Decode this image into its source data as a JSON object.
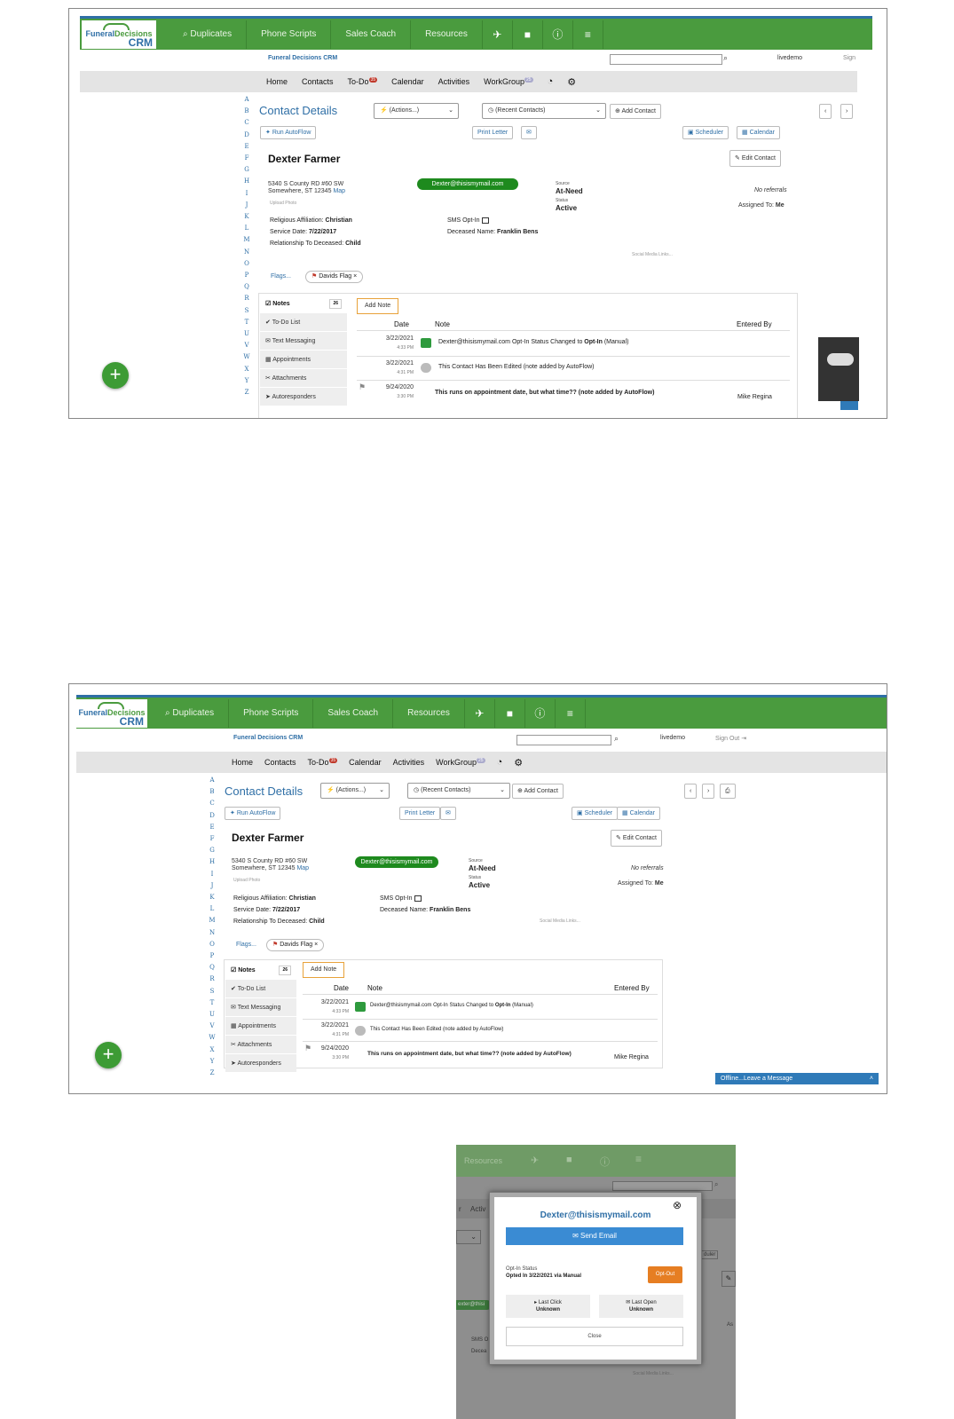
{
  "app": {
    "logo_line1a": "Funeral",
    "logo_line1b": "Decisions",
    "logo_line2": "CRM",
    "subtitle": "Funeral Decisions CRM",
    "username": "livedemo",
    "signin_cut": "Sign",
    "signout": "Sign Out"
  },
  "nav": [
    {
      "label": "Duplicates",
      "icon": "search-icon"
    },
    {
      "label": "Phone Scripts"
    },
    {
      "label": "Sales Coach"
    },
    {
      "label": "Resources"
    }
  ],
  "nav_icons": [
    "rocket-icon",
    "note-icon",
    "help-icon",
    "hamburger-icon"
  ],
  "menu": {
    "home": "Home",
    "contacts": "Contacts",
    "todo": "To-Do",
    "todo_count": "35",
    "calendar": "Calendar",
    "activities": "Activities",
    "workgroup": "WorkGroup",
    "workgroup_count": "25"
  },
  "alphabet": [
    "A",
    "B",
    "C",
    "D",
    "E",
    "F",
    "G",
    "H",
    "I",
    "J",
    "K",
    "L",
    "M",
    "N",
    "O",
    "P",
    "Q",
    "R",
    "S",
    "T",
    "U",
    "V",
    "W",
    "X",
    "Y",
    "Z"
  ],
  "contact": {
    "page_title": "Contact Details",
    "actions_select": "(Actions...)",
    "recent_select": "(Recent Contacts)",
    "add_contact": "Add Contact",
    "run_autoflow": "Run AutoFlow",
    "print_letter": "Print Letter",
    "scheduler": "Scheduler",
    "calendar": "Calendar",
    "edit_contact": "Edit Contact",
    "name": "Dexter Farmer",
    "address1": "5340 S County RD #60 SW",
    "address2": "Somewhere, ST 12345",
    "map": "Map",
    "upload_photo": "Upload Photo",
    "email": "Dexter@thisismymail.com",
    "source_label": "Source",
    "source": "At-Need",
    "status_label": "Status",
    "status": "Active",
    "no_referrals": "No referrals",
    "assigned_label": "Assigned To:",
    "assigned": "Me",
    "religious_label": "Religious Affiliation:",
    "religious": "Christian",
    "service_label": "Service Date:",
    "service": "7/22/2017",
    "relationship_label": "Relationship To Deceased:",
    "relationship": "Child",
    "sms_label": "SMS Opt-In",
    "deceased_label": "Deceased Name:",
    "deceased": "Franklin Bens",
    "social": "Social Media Links...",
    "flags_label": "Flags...",
    "flag_name": "Davids Flag"
  },
  "tabs": [
    {
      "label": "Notes",
      "count": "26"
    },
    {
      "label": "To-Do List"
    },
    {
      "label": "Text Messaging"
    },
    {
      "label": "Appointments"
    },
    {
      "label": "Attachments"
    },
    {
      "label": "Autoresponders"
    }
  ],
  "notes": {
    "add_note": "Add Note",
    "col_date": "Date",
    "col_note": "Note",
    "col_entered": "Entered By",
    "rows": [
      {
        "date": "3/22/2021",
        "time": "4:33 PM",
        "text_a": "Dexter@thisismymail.com Opt-In Status Changed to ",
        "text_b": "Opt-In",
        "text_c": " (Manual)",
        "by": ""
      },
      {
        "date": "3/22/2021",
        "time": "4:31 PM",
        "text_a": "This Contact Has Been Edited (note added by AutoFlow)",
        "by": ""
      },
      {
        "date": "9/24/2020",
        "time": "3:30 PM",
        "text_a": "This runs on appointment date, but what time?? (note added by AutoFlow)",
        "by": "Mike Regina"
      }
    ]
  },
  "offline": "Offline...Leave a Message",
  "popup": {
    "nav_resources": "Resources",
    "partial_r": "r",
    "partial_activ": "Activ",
    "partial_email": "exter@thisi",
    "partial_sms": "SMS O",
    "partial_decea": "Decea",
    "partial_dule": "duler",
    "partial_as": "As",
    "partial_social": "Social Media Links...",
    "email": "Dexter@thisismymail.com",
    "send_email": "Send Email",
    "optin_label": "Opt-In Status",
    "optin_value": "Opted In 3/22/2021 via Manual",
    "opt_out": "Opt-Out",
    "last_click": "Last Click",
    "last_click_val": "Unknown",
    "last_open": "Last Open",
    "last_open_val": "Unknown",
    "close": "Close"
  },
  "colors": {
    "green": "#4a9b3e",
    "blue": "#2f6fa6",
    "orange": "#e67e22",
    "email_green": "#1e8a1e"
  }
}
